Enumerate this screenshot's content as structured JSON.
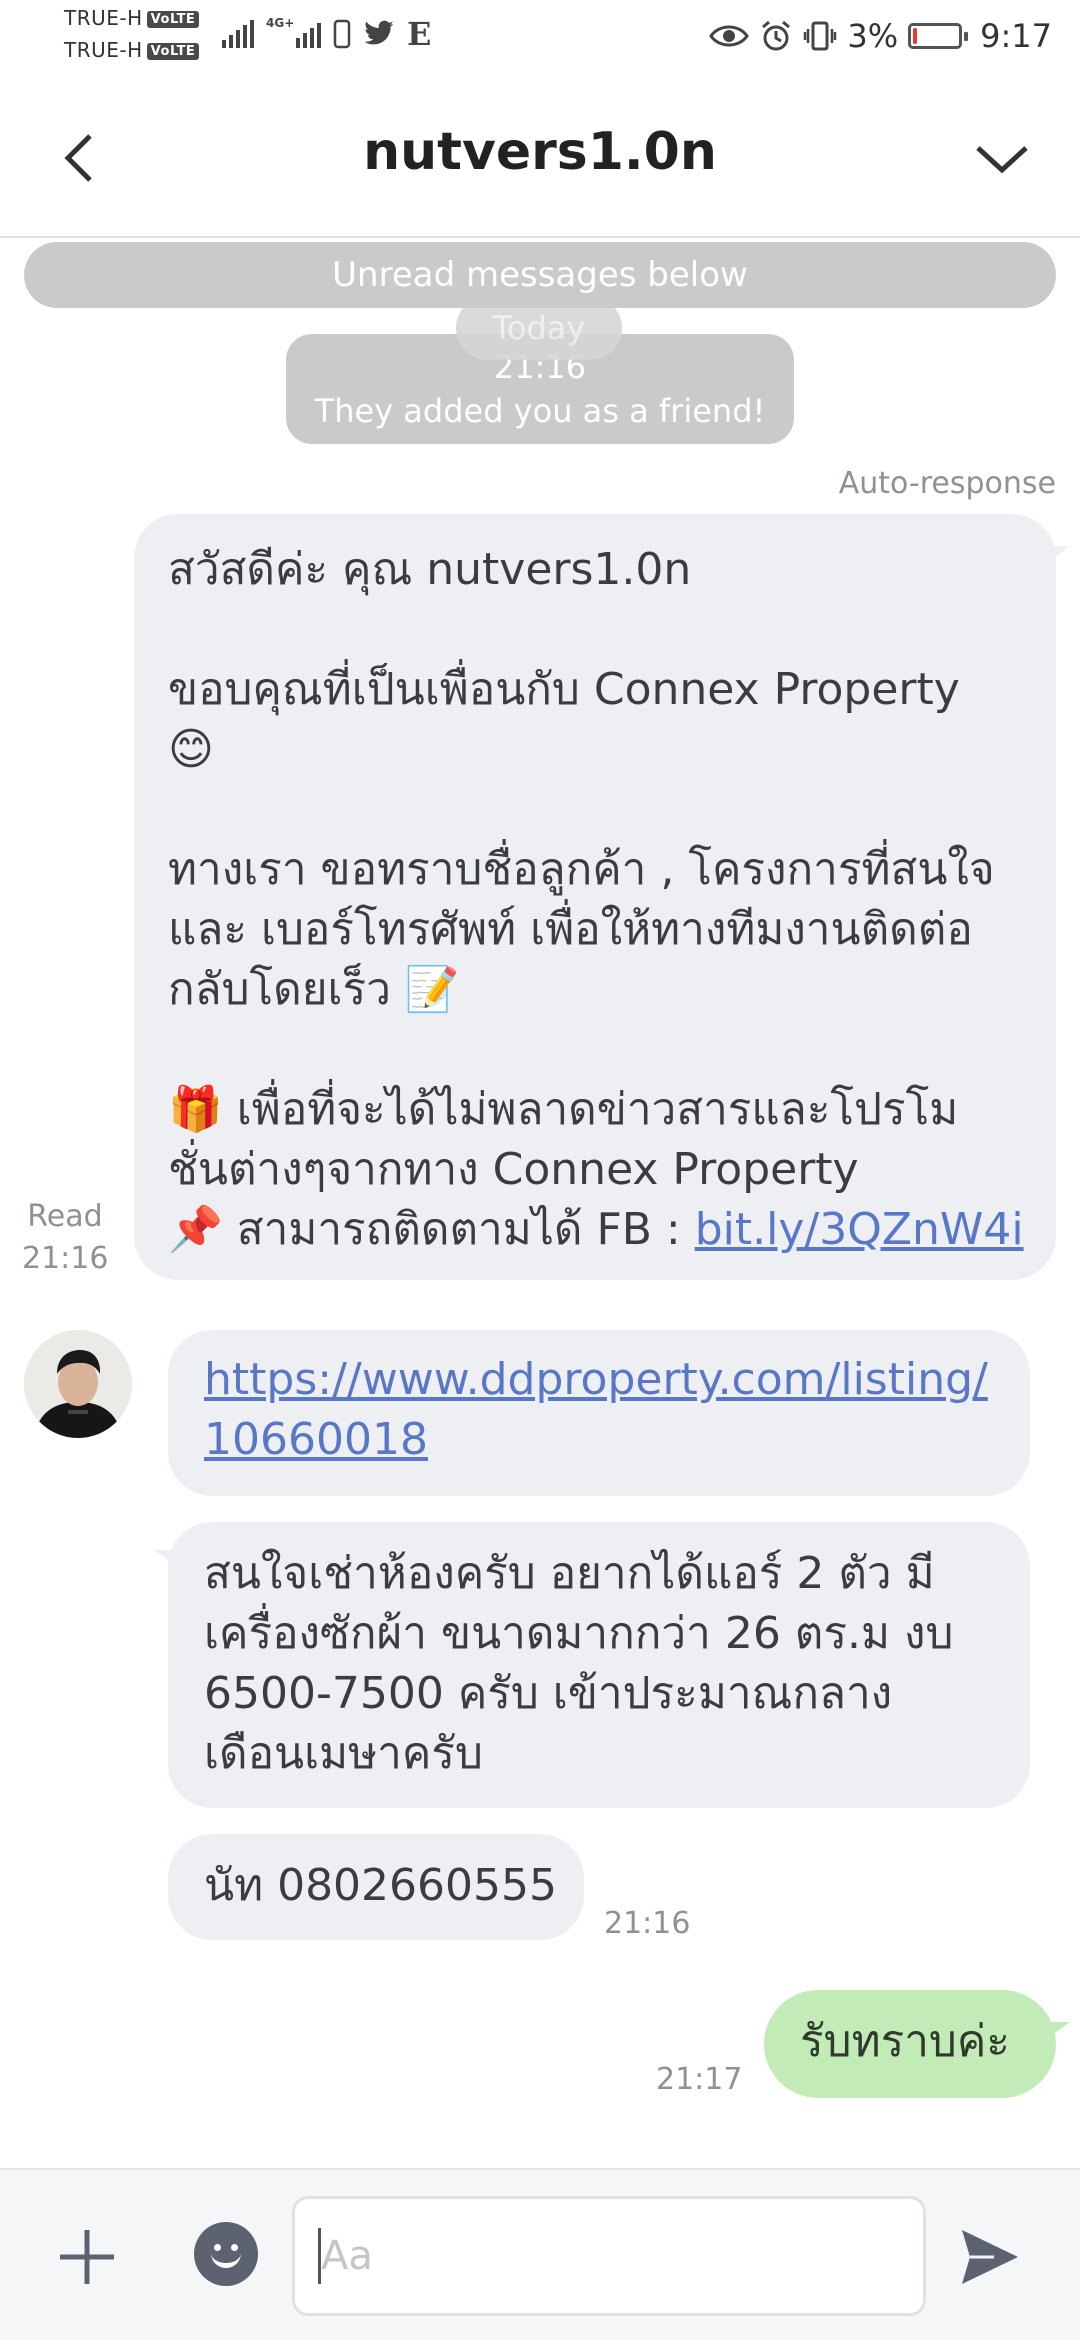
{
  "status_bar": {
    "carrier_1": "TRUE-H",
    "carrier_2": "TRUE-H",
    "volte": "VoLTE",
    "network": "4G+",
    "battery_percent": "3%",
    "battery_level": 0.03,
    "time": "9:17",
    "icons": [
      "signal-icon",
      "sim-icon",
      "twitter-icon",
      "e-app-icon",
      "eye-icon",
      "alarm-icon",
      "vibrate-icon",
      "battery-icon"
    ]
  },
  "header": {
    "title": "nutvers1.0n"
  },
  "system": {
    "unread_label": "Unread messages below",
    "date_label": "Today",
    "friend_time": "21:16",
    "friend_text": "They added you as a friend!"
  },
  "auto_response_label": "Auto-response",
  "read_status": {
    "label": "Read",
    "time": "21:16"
  },
  "outgoing_auto": {
    "lines": [
      "สวัสดีค่ะ คุณ nutvers1.0n",
      "",
      "ขอบคุณที่เป็นเพื่อนกับ Connex Property",
      "😊",
      "",
      "ทางเรา ขอทราบชื่อลูกค้า , โครงการที่สนใจ",
      "และ เบอร์โทรศัพท์ เพื่อให้ทางทีมงานติดต่อ",
      "กลับโดยเร็ว 📝",
      "",
      "🎁 เพื่อที่จะได้ไม่พลาดข่าวสารและโปรโม",
      "ชั่นต่างๆจากทาง Connex Property"
    ],
    "last_line_prefix": "📌 สามารถติดตามได้ FB : ",
    "link": "bit.ly/3QZnW4i"
  },
  "incoming": {
    "link_line_1": "https://www.ddproperty.com/listing/",
    "link_line_2": "10660018",
    "message_lines": [
      "สนใจเช่าห้องครับ อยากได้แอร์ 2 ตัว มี",
      "เครื่องซักผ้า ขนาดมากกว่า 26 ตร.ม งบ",
      "6500-7500 ครับ  เข้าประมาณกลาง",
      "เดือนเมษาครับ"
    ],
    "phone_message": "นัท 0802660555",
    "time": "21:16"
  },
  "reply": {
    "text": "รับทราบค่ะ",
    "time": "21:17"
  },
  "input_bar": {
    "placeholder": "Aa"
  },
  "colors": {
    "incoming_bubble": "#eeeff2",
    "outgoing_bubble": "#c2ebb7",
    "system_pill": "#c9cacc",
    "link": "#5877c7",
    "battery_low": "#e53935"
  }
}
